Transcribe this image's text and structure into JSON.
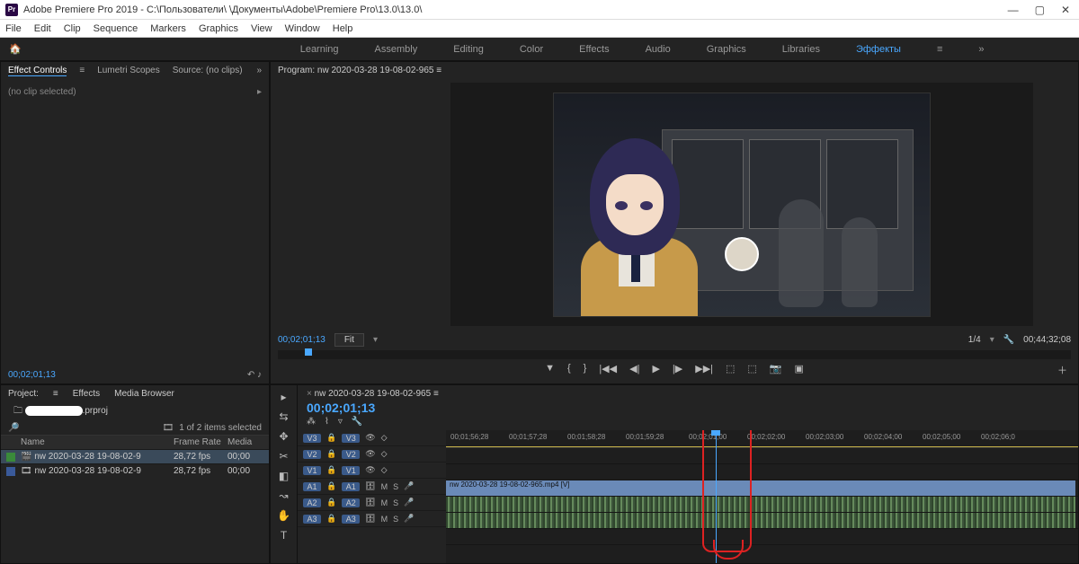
{
  "titlebar": {
    "app": "Adobe Premiere Pro 2019",
    "path": " - C:\\Пользователи\\          \\Документы\\Adobe\\Premiere Pro\\13.0\\13.0\\"
  },
  "menu": [
    "File",
    "Edit",
    "Clip",
    "Sequence",
    "Markers",
    "Graphics",
    "View",
    "Window",
    "Help"
  ],
  "workspaces": [
    "Learning",
    "Assembly",
    "Editing",
    "Color",
    "Effects",
    "Audio",
    "Graphics",
    "Libraries",
    "Эффекты"
  ],
  "workspace_active": "Эффекты",
  "topleft": {
    "tabs": [
      "Effect Controls",
      "Lumetri Scopes",
      "Source: (no clips)"
    ],
    "noclip": "(no clip selected)",
    "bottom_tc": "00;02;01;13"
  },
  "program": {
    "tab": "Program: nw 2020-03-28 19-08-02-965",
    "tc_left": "00;02;01;13",
    "fit": "Fit",
    "zoom": "1/4",
    "tc_right": "00;44;32;08"
  },
  "project": {
    "tabs": [
      "Project:",
      "Effects",
      "Media Browser"
    ],
    "name": ".prproj",
    "selection": "1 of 2 items selected",
    "columns": [
      "Name",
      "Frame Rate",
      "Media"
    ],
    "rows": [
      {
        "color": "g",
        "name": "nw 2020-03-28 19-08-02-9",
        "fps": "28,72 fps",
        "media": "00;00",
        "sel": true
      },
      {
        "color": "b",
        "name": "nw 2020-03-28 19-08-02-9",
        "fps": "28,72 fps",
        "media": "00;00",
        "sel": false
      }
    ]
  },
  "timeline": {
    "seq": "nw 2020-03-28 19-08-02-965",
    "tc": "00;02;01;13",
    "ruler": [
      "00;01;56;28",
      "00;01;57;28",
      "00;01;58;28",
      "00;01;59;28",
      "00;02;01;00",
      "00;02;02;00",
      "00;02;03;00",
      "00;02;04;00",
      "00;02;05;00",
      "00;02;06;0"
    ],
    "video_tracks": [
      "V3",
      "V2",
      "V1"
    ],
    "audio_tracks": [
      "A1",
      "A2",
      "A3"
    ],
    "clip_name": "nw 2020-03-28 19-08-02-965.mp4 [V]",
    "tools": [
      "▸",
      "⇆",
      "✥",
      "✂",
      "◧",
      "↝",
      "✋",
      "T"
    ]
  }
}
